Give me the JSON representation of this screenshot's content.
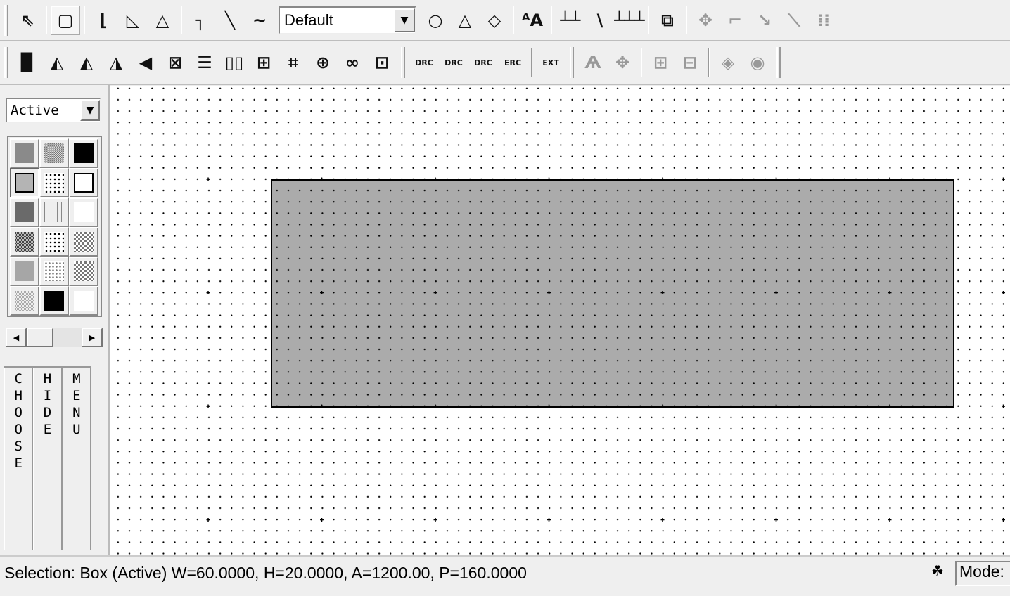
{
  "toolbar1": {
    "wire_style": "Default"
  },
  "toolbar2": {
    "drc_label": "DRC",
    "erc_label": "ERC",
    "ext_label": "EXT"
  },
  "left_panel": {
    "layer_filter": "Active",
    "tabs": [
      "CHOOSE",
      "HIDE",
      "MENU"
    ],
    "swatches": [
      "#8a8a8a",
      "pattern-dots-fine",
      "#000000",
      "#b4b4b4-selected",
      "pattern-diag-dots",
      "#ffffff-outline",
      "#6a6a6a",
      "pattern-lattice",
      "#ffffff",
      "pattern-dense",
      "pattern-diag-dots",
      "pattern-checker",
      "#a6a6a6",
      "pattern-sparse-dots",
      "pattern-checker",
      "pattern-fine",
      "#000000",
      "#ffffff"
    ]
  },
  "canvas": {
    "selected_object": {
      "type": "Box",
      "layer": "Active",
      "width": 60,
      "height": 20,
      "fill": "#ababab"
    }
  },
  "status": {
    "text": "Selection: Box (Active) W=60.0000, H=20.0000, A=1200.00, P=160.0000",
    "mode_label": "Mode:"
  }
}
